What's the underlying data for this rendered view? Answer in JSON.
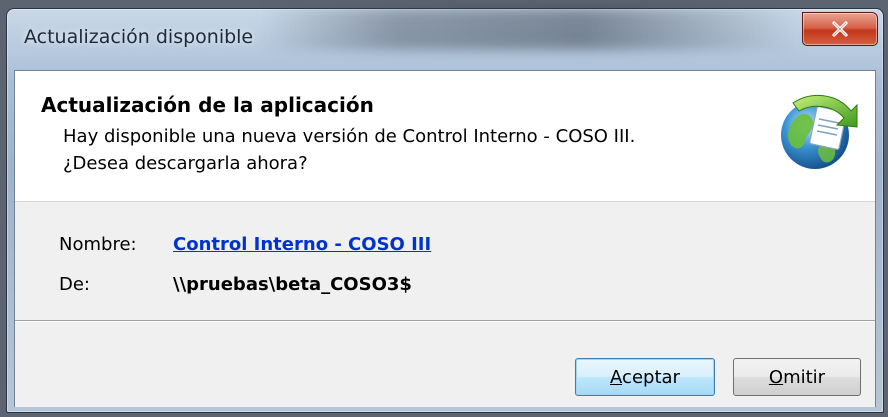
{
  "window": {
    "title": "Actualización disponible",
    "close_icon": "close-icon"
  },
  "header": {
    "title": "Actualización de la aplicación",
    "line1": "Hay disponible una nueva versión de Control Interno - COSO III.",
    "line2": "¿Desea descargarla ahora?",
    "logo_icon": "globe-update-icon"
  },
  "details": {
    "name_label": "Nombre:",
    "name_value": "Control Interno - COSO III",
    "from_label": "De:",
    "from_value": "\\\\pruebas\\beta_COSO3$"
  },
  "buttons": {
    "accept_label": "Aceptar",
    "skip_label": "Omitir"
  },
  "colors": {
    "link": "#0033cc",
    "close_button": "#c2371b",
    "dialog_bg": "#f0f0f0",
    "header_bg": "#ffffff"
  }
}
